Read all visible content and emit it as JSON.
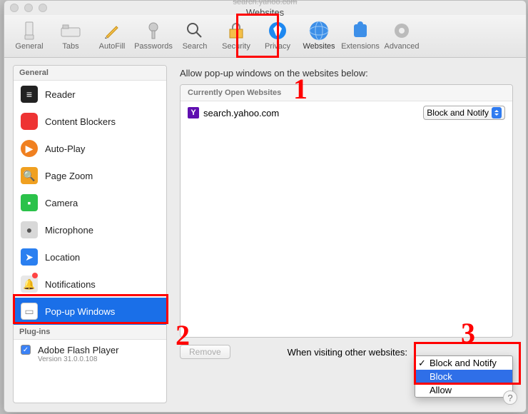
{
  "window": {
    "url_partial": "search.yahoo.com",
    "title": "Websites"
  },
  "toolbar": [
    {
      "label": "General"
    },
    {
      "label": "Tabs"
    },
    {
      "label": "AutoFill"
    },
    {
      "label": "Passwords"
    },
    {
      "label": "Search"
    },
    {
      "label": "Security"
    },
    {
      "label": "Privacy"
    },
    {
      "label": "Websites"
    },
    {
      "label": "Extensions"
    },
    {
      "label": "Advanced"
    }
  ],
  "sidebar": {
    "section_general": "General",
    "items": [
      {
        "label": "Reader"
      },
      {
        "label": "Content Blockers"
      },
      {
        "label": "Auto-Play"
      },
      {
        "label": "Page Zoom"
      },
      {
        "label": "Camera"
      },
      {
        "label": "Microphone"
      },
      {
        "label": "Location"
      },
      {
        "label": "Notifications"
      },
      {
        "label": "Pop-up Windows"
      }
    ],
    "section_plugins": "Plug-ins",
    "plugin": {
      "label": "Adobe Flash Player",
      "version": "Version 31.0.0.108"
    }
  },
  "main": {
    "instruction": "Allow pop-up windows on the websites below:",
    "list_header": "Currently Open Websites",
    "rows": [
      {
        "domain": "search.yahoo.com",
        "setting": "Block and Notify"
      }
    ],
    "remove_label": "Remove",
    "other_label": "When visiting other websites:"
  },
  "dropdown": {
    "items": [
      "Block and Notify",
      "Block",
      "Allow"
    ],
    "checked": "Block and Notify",
    "highlighted": "Block"
  },
  "annotations": {
    "n1": "1",
    "n2": "2",
    "n3": "3"
  }
}
